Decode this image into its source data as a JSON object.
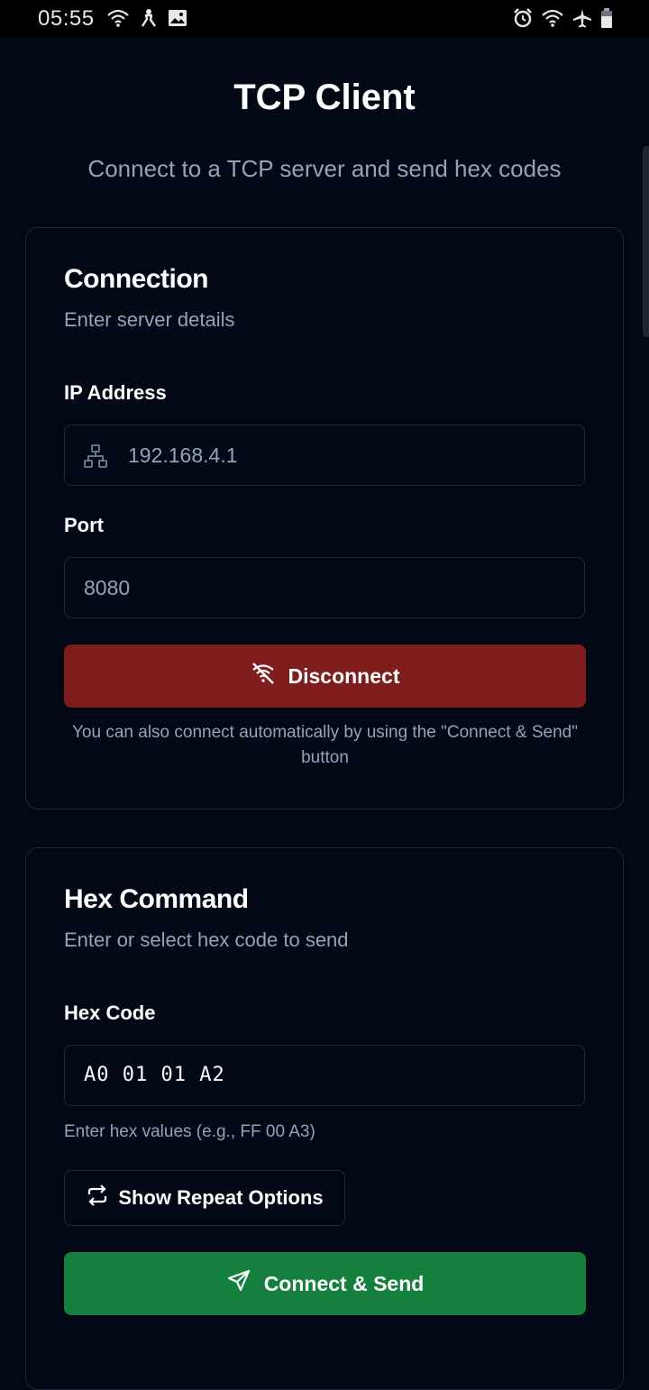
{
  "status_bar": {
    "time": "05:55",
    "left_icons": [
      "wifi-icon",
      "accessibility-icon",
      "image-icon"
    ],
    "right_icons": [
      "alarm-icon",
      "wifi-icon",
      "airplane-mode-icon",
      "battery-icon"
    ]
  },
  "header": {
    "title": "TCP Client",
    "subtitle": "Connect to a TCP server and send hex codes"
  },
  "connection": {
    "title": "Connection",
    "description": "Enter server details",
    "ip_label": "IP Address",
    "ip_value": "192.168.4.1",
    "ip_icon": "network-icon",
    "port_label": "Port",
    "port_value": "8080",
    "disconnect_label": "Disconnect",
    "disconnect_icon": "wifi-off-icon",
    "hint": "You can also connect automatically by using the \"Connect & Send\" button"
  },
  "hex_command": {
    "title": "Hex Command",
    "description": "Enter or select hex code to send",
    "hex_label": "Hex Code",
    "hex_value": "A0 01 01 A2",
    "helper": "Enter hex values (e.g., FF 00 A3)",
    "repeat_label": "Show Repeat Options",
    "repeat_icon": "repeat-icon",
    "send_label": "Connect & Send",
    "send_icon": "send-icon"
  },
  "colors": {
    "background": "#030816",
    "disconnect": "#7f1d1d",
    "send": "#15803d",
    "muted_text": "#94a3b8"
  }
}
